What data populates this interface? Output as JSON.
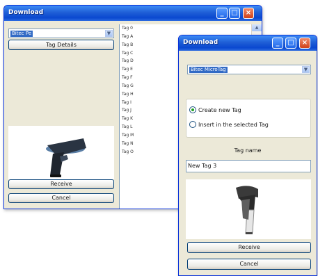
{
  "back_window": {
    "title": "Download",
    "device_select": {
      "value": "Bitec Pe"
    },
    "tag_details_label": "Tag Details",
    "tags": [
      "Tag 0",
      "Tag A",
      "Tag B",
      "Tag C",
      "Tag D",
      "Tag E",
      "Tag F",
      "Tag G",
      "Tag H",
      "Tag I",
      "Tag J",
      "Tag K",
      "Tag L",
      "Tag M",
      "Tag N",
      "Tag O"
    ],
    "receive_label": "Receive",
    "cancel_label": "Cancel"
  },
  "front_window": {
    "title": "Download",
    "device_select": {
      "value": "Bitec MicroTag"
    },
    "options": {
      "create_new": "Create new Tag",
      "insert_selected": "Insert in the selected Tag",
      "selected": "create_new"
    },
    "tag_name_label": "Tag name",
    "tag_name_value": "New Tag 3",
    "receive_label": "Receive",
    "cancel_label": "Cancel"
  },
  "title_buttons": {
    "minimize": "_",
    "maximize": "□",
    "close": "×"
  },
  "colors": {
    "titlebar": "#1f5fd6",
    "selection": "#316ac5",
    "window_bg": "#ece9d8",
    "close_button": "#d0421a"
  }
}
